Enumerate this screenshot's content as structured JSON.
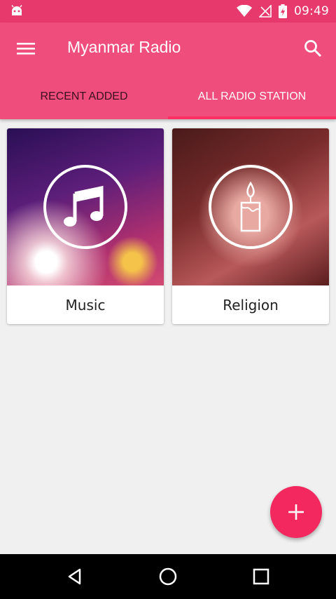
{
  "status_bar": {
    "time": "09:49",
    "icons": [
      "android-notification-icon",
      "wifi-icon",
      "no-signal-icon",
      "battery-charging-icon"
    ]
  },
  "app_bar": {
    "title": "Myanmar Radio",
    "menu_icon": "hamburger-menu-icon",
    "search_icon": "search-icon"
  },
  "tabs": [
    {
      "label": "RECENT ADDED",
      "active": false
    },
    {
      "label": "ALL RADIO STATION",
      "active": true
    }
  ],
  "categories": [
    {
      "label": "Music",
      "icon": "music-note-icon"
    },
    {
      "label": "Religion",
      "icon": "candle-icon"
    }
  ],
  "fab": {
    "icon": "plus-icon"
  },
  "nav_bar": {
    "icons": [
      "back-icon",
      "home-icon",
      "recents-icon"
    ]
  },
  "colors": {
    "status_bar": "#e8396c",
    "app_bar": "#ef4d7b",
    "accent": "#f2285e"
  }
}
